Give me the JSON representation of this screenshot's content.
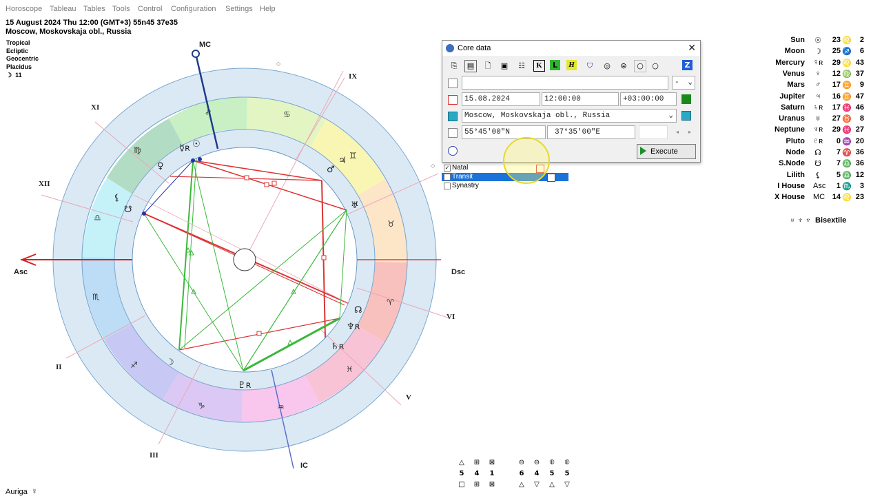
{
  "menu": [
    "Horoscope",
    "Tableau",
    "Tables",
    "Tools",
    "Control",
    "Configuration",
    "Settings",
    "Help"
  ],
  "header": {
    "line1": "15 August 2024  Thu  12:00 (GMT+3) 55n45  37e35",
    "line2": "Moscow, Moskovskaja obl., Russia"
  },
  "chart_settings": {
    "zodiac": "Tropical",
    "coords": "Ecliptic",
    "center": "Geocentric",
    "houses": "Placidus",
    "moon_day_symbol": "☽",
    "moon_day": "11"
  },
  "wheel": {
    "axis_labels": {
      "asc": "Asc",
      "dsc": "Dsc",
      "mc": "MC",
      "ic": "IC"
    },
    "house_labels": {
      "II": "II",
      "III": "III",
      "V": "V",
      "VI": "VI",
      "IX": "IX",
      "XI": "XI",
      "XII": "XII"
    },
    "house_cusp_marks": [
      "◇",
      "◇"
    ],
    "zodiac_glyphs": [
      "♌",
      "♋",
      "♊",
      "♉",
      "♈",
      "♓",
      "♒",
      "♑",
      "♐",
      "♏",
      "♎",
      "♍"
    ],
    "planet_glyphs": {
      "mercury": "☿ʀ",
      "venus": "♀",
      "mars": "♂",
      "jupiter": "♃",
      "uranus": "♅",
      "lilith": "⚸",
      "snode": "☋",
      "moon": "☽",
      "pluto": "♇ʀ",
      "neptune": "♆ʀ",
      "saturn": "♄ʀ",
      "node": "☊",
      "sun": "☉"
    }
  },
  "planets": [
    {
      "name": "Sun",
      "symbol": "☉",
      "deg": "23",
      "sign": "♌",
      "min": "2"
    },
    {
      "name": "Moon",
      "symbol": "☽",
      "deg": "25",
      "sign": "♐",
      "min": "6"
    },
    {
      "name": "Mercury",
      "symbol": "☿ʀ",
      "deg": "29",
      "sign": "♌",
      "min": "43"
    },
    {
      "name": "Venus",
      "symbol": "♀",
      "deg": "12",
      "sign": "♍",
      "min": "37"
    },
    {
      "name": "Mars",
      "symbol": "♂",
      "deg": "17",
      "sign": "♊",
      "min": "9"
    },
    {
      "name": "Jupiter",
      "symbol": "♃",
      "deg": "16",
      "sign": "♊",
      "min": "47"
    },
    {
      "name": "Saturn",
      "symbol": "♄ʀ",
      "deg": "17",
      "sign": "♓",
      "min": "46"
    },
    {
      "name": "Uranus",
      "symbol": "♅",
      "deg": "27",
      "sign": "♉",
      "min": "8"
    },
    {
      "name": "Neptune",
      "symbol": "♆ʀ",
      "deg": "29",
      "sign": "♓",
      "min": "27"
    },
    {
      "name": "Pluto",
      "symbol": "♇ʀ",
      "deg": "0",
      "sign": "♒",
      "min": "20"
    },
    {
      "name": "Node",
      "symbol": "☊",
      "deg": "7",
      "sign": "♈",
      "min": "36"
    },
    {
      "name": "S.Node",
      "symbol": "☋",
      "deg": "7",
      "sign": "♎",
      "min": "36"
    },
    {
      "name": "Lilith",
      "symbol": "⚸",
      "deg": "5",
      "sign": "♎",
      "min": "12"
    },
    {
      "name": "I House",
      "symbol": "Asc",
      "deg": "1",
      "sign": "♏",
      "min": "3"
    },
    {
      "name": "X House",
      "symbol": "MC",
      "deg": "14",
      "sign": "♌",
      "min": "23"
    }
  ],
  "bisextile": {
    "symbols": "♅ ♆ ♆",
    "label": "Bisextile"
  },
  "dialog": {
    "title": "Core data",
    "toolbar_icons": [
      "copy",
      "paste",
      "new",
      "save",
      "table",
      "K",
      "L",
      "H",
      "shield",
      "circle-a",
      "circle-s",
      "ring1",
      "ring2",
      "Z"
    ],
    "toolbar_labels": {
      "K": "K",
      "L": "L",
      "H": "H",
      "Z": "Z"
    },
    "name_value": "",
    "name_dropdown": "-",
    "date": "15.08.2024",
    "time": "12:00:00",
    "tz": "+03:00:00",
    "place": "Moscow, Moskovskaja obl., Russia",
    "lat": "55°45'00\"N",
    "lon": "37°35'00\"E",
    "extra": "",
    "execute": "Execute"
  },
  "modes": [
    {
      "label": "Natal",
      "checked": true
    },
    {
      "label": "Transit",
      "checked": false
    },
    {
      "label": "Synastry",
      "checked": false
    }
  ],
  "checkmark": "✓",
  "stats_top": [
    {
      "icon": "△",
      "val": "5"
    },
    {
      "icon": "⊞",
      "val": "4"
    },
    {
      "icon": "⊠",
      "val": "1"
    },
    {
      "icon": "⊖",
      "val": "6"
    },
    {
      "icon": "⊖",
      "val": "4"
    },
    {
      "icon": "⦶",
      "val": "5"
    },
    {
      "icon": "⦶",
      "val": "5"
    }
  ],
  "stats_bottom": [
    "□",
    "⊞",
    "⊠",
    "△",
    "▽",
    "△",
    "▽"
  ],
  "footer": {
    "label": "Auriga",
    "symbol": "☿"
  }
}
